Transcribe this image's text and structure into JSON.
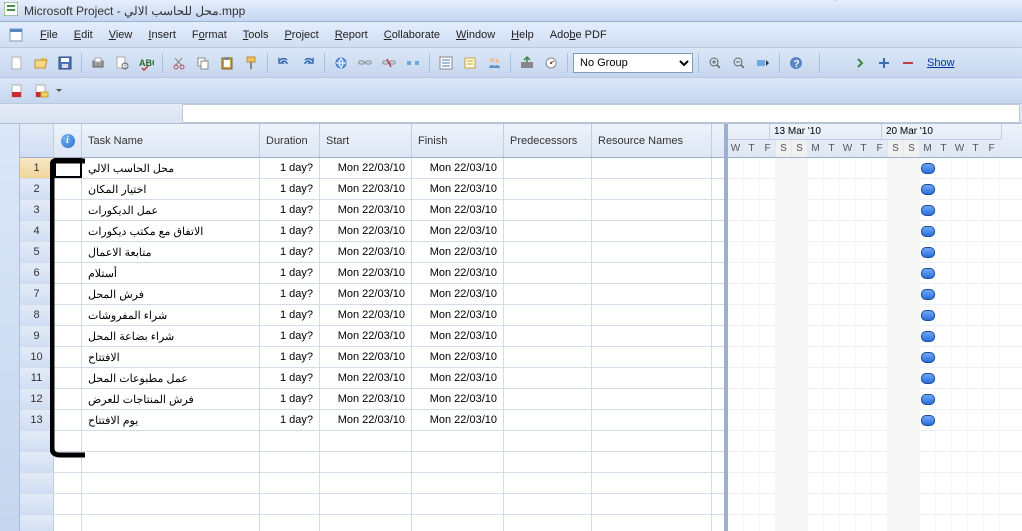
{
  "title": "Microsoft Project - محل للحاسب الالي.mpp",
  "menubar": [
    "File",
    "Edit",
    "View",
    "Insert",
    "Format",
    "Tools",
    "Project",
    "Report",
    "Collaborate",
    "Window",
    "Help",
    "Adobe PDF"
  ],
  "toolbar": {
    "group_label": "No Group",
    "show_label": "Show"
  },
  "columns": {
    "task": "Task Name",
    "duration": "Duration",
    "start": "Start",
    "finish": "Finish",
    "predecessors": "Predecessors",
    "resources": "Resource Names"
  },
  "gantt": {
    "weeks": [
      "",
      "13 Mar '10",
      "20 Mar '10"
    ],
    "days": [
      "W",
      "T",
      "F",
      "S",
      "S",
      "M",
      "T",
      "W",
      "T",
      "F",
      "S",
      "S",
      "M",
      "T",
      "W",
      "T",
      "F"
    ],
    "weekend": [
      "F",
      "S"
    ]
  },
  "tasks": [
    {
      "id": 1,
      "name": "محل الحاسب الالي",
      "dur": "1 day?",
      "start": "Mon 22/03/10",
      "finish": "Mon 22/03/10"
    },
    {
      "id": 2,
      "name": "اختيار المكان",
      "dur": "1 day?",
      "start": "Mon 22/03/10",
      "finish": "Mon 22/03/10"
    },
    {
      "id": 3,
      "name": "عمل الديكورات",
      "dur": "1 day?",
      "start": "Mon 22/03/10",
      "finish": "Mon 22/03/10"
    },
    {
      "id": 4,
      "name": "الاتفاق مع مكتب ديكورات",
      "dur": "1 day?",
      "start": "Mon 22/03/10",
      "finish": "Mon 22/03/10"
    },
    {
      "id": 5,
      "name": "متابعة الاعمال",
      "dur": "1 day?",
      "start": "Mon 22/03/10",
      "finish": "Mon 22/03/10"
    },
    {
      "id": 6,
      "name": "أستلام",
      "dur": "1 day?",
      "start": "Mon 22/03/10",
      "finish": "Mon 22/03/10"
    },
    {
      "id": 7,
      "name": "فرش المحل",
      "dur": "1 day?",
      "start": "Mon 22/03/10",
      "finish": "Mon 22/03/10"
    },
    {
      "id": 8,
      "name": "شراء المفروشات",
      "dur": "1 day?",
      "start": "Mon 22/03/10",
      "finish": "Mon 22/03/10"
    },
    {
      "id": 9,
      "name": "شراء بضاعة المحل",
      "dur": "1 day?",
      "start": "Mon 22/03/10",
      "finish": "Mon 22/03/10"
    },
    {
      "id": 10,
      "name": "الافتتاح",
      "dur": "1 day?",
      "start": "Mon 22/03/10",
      "finish": "Mon 22/03/10"
    },
    {
      "id": 11,
      "name": "عمل مطبوعات المحل",
      "dur": "1 day?",
      "start": "Mon 22/03/10",
      "finish": "Mon 22/03/10"
    },
    {
      "id": 12,
      "name": "فرش المنتاجات للعرض",
      "dur": "1 day?",
      "start": "Mon 22/03/10",
      "finish": "Mon 22/03/10"
    },
    {
      "id": 13,
      "name": "يوم الافتتاح",
      "dur": "1 day?",
      "start": "Mon 22/03/10",
      "finish": "Mon 22/03/10"
    }
  ]
}
